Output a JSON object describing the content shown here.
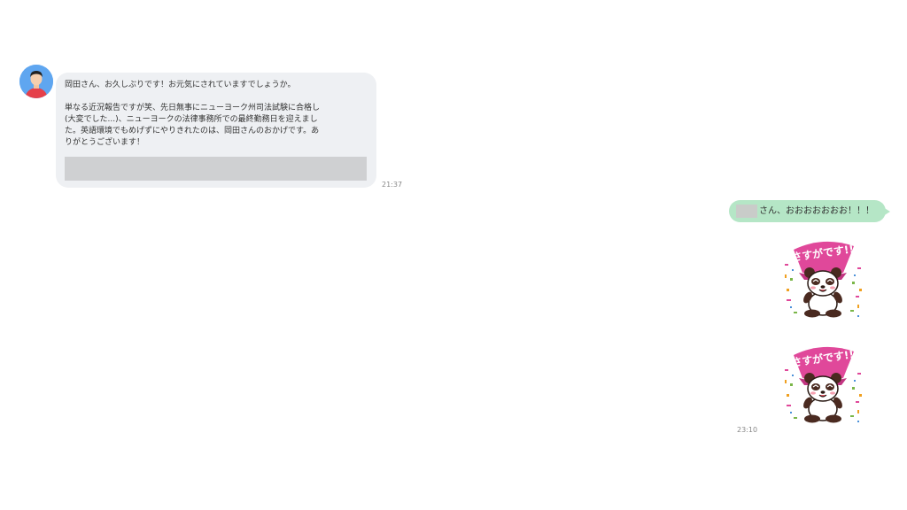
{
  "incoming": {
    "sender_avatar": "avatar-man-icon",
    "lines": [
      "岡田さん、お久しぶりです！お元気にされていますでしょうか。",
      "",
      "単なる近況報告ですが笑、先日無事にニューヨーク州司法試験に合格し",
      "(大変でした...)、ニューヨークの法律事務所での最終勤務日を迎えまし",
      "た。英語環境でもめげずにやりきれたのは、岡田さんのおかげです。あ",
      "りがとうございます！"
    ],
    "time": "21:37"
  },
  "outgoing": {
    "message": "さん、おおおおおおお！！！",
    "stickers": [
      {
        "name": "panda-sticker",
        "text": "さすがです!!"
      },
      {
        "name": "panda-sticker",
        "text": "さすがです!!"
      }
    ],
    "time": "23:10"
  },
  "colors": {
    "incoming_bubble": "#eef0f3",
    "outgoing_bubble": "#b5e6c6",
    "sticker_banner": "#e0489a"
  }
}
